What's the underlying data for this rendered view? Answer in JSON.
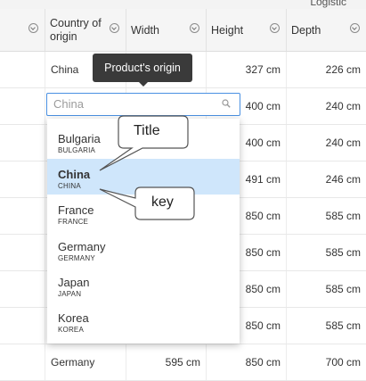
{
  "group_header": {
    "label": "Logistic"
  },
  "columns": [
    {
      "label": ""
    },
    {
      "label": "Country of origin"
    },
    {
      "label": "Width"
    },
    {
      "label": "Height"
    },
    {
      "label": "Depth"
    }
  ],
  "rows": [
    {
      "country": "China",
      "width": "",
      "height": "327 cm",
      "depth": "226 cm"
    },
    {
      "country": "",
      "width": "",
      "height": "400 cm",
      "depth": "240 cm"
    },
    {
      "country": "",
      "width": "",
      "height": "400 cm",
      "depth": "240 cm"
    },
    {
      "country": "",
      "width": "",
      "height": "491 cm",
      "depth": "246 cm"
    },
    {
      "country": "",
      "width": "",
      "height": "850 cm",
      "depth": "585 cm"
    },
    {
      "country": "",
      "width": "",
      "height": "850 cm",
      "depth": "585 cm"
    },
    {
      "country": "",
      "width": "",
      "height": "850 cm",
      "depth": "585 cm"
    },
    {
      "country": "",
      "width": "",
      "height": "850 cm",
      "depth": "585 cm"
    },
    {
      "country": "Germany",
      "width": "595 cm",
      "height": "850 cm",
      "depth": "700 cm"
    }
  ],
  "tooltip": {
    "text": "Product's origin"
  },
  "search": {
    "placeholder": "China",
    "value": ""
  },
  "dropdown": {
    "items": [
      {
        "title": "Bulgaria",
        "key": "BULGARIA",
        "selected": false
      },
      {
        "title": "China",
        "key": "CHINA",
        "selected": true
      },
      {
        "title": "France",
        "key": "FRANCE",
        "selected": false
      },
      {
        "title": "Germany",
        "key": "GERMANY",
        "selected": false
      },
      {
        "title": "Japan",
        "key": "JAPAN",
        "selected": false
      },
      {
        "title": "Korea",
        "key": "KOREA",
        "selected": false
      }
    ]
  },
  "annotations": {
    "title_callout": "Title",
    "key_callout": "key"
  },
  "colors": {
    "accent": "#4a90e2",
    "selected_bg": "#cfe6fb",
    "tooltip_bg": "#3a3a3a"
  },
  "icons": {
    "column_menu": "column-menu-icon",
    "search": "search-icon"
  }
}
